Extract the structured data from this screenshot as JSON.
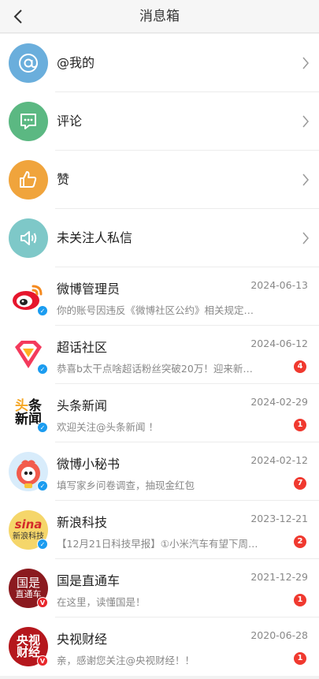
{
  "header": {
    "title": "消息箱"
  },
  "colors": {
    "at": "#6aaedc",
    "comment": "#5bb882",
    "like": "#f0a43c",
    "stranger": "#7ec8c8",
    "unread": "#f0392f",
    "verified_blue": "#1b9cf0",
    "verified_red": "#e8262b"
  },
  "categories": [
    {
      "label": "@我的",
      "icon": "at-icon"
    },
    {
      "label": "评论",
      "icon": "comment-icon"
    },
    {
      "label": "赞",
      "icon": "thumbs-up-icon"
    },
    {
      "label": "未关注人私信",
      "icon": "speaker-icon"
    }
  ],
  "messages": [
    {
      "name": "微博管理员",
      "date": "2024-06-13",
      "preview": "你的账号因违反《微博社区公约》相关规定，…",
      "unread": "",
      "badge": "blue"
    },
    {
      "name": "超话社区",
      "date": "2024-06-12",
      "preview": "恭喜b太干点啥超话粉丝突破20万！迎来新的…",
      "unread": "4",
      "badge": "blue"
    },
    {
      "name": "头条新闻",
      "date": "2024-02-29",
      "preview": "欢迎关注@头条新闻 ！",
      "unread": "1",
      "badge": "blue",
      "logo_line1_a": "头",
      "logo_line1_b": "条",
      "logo_line2": "新闻"
    },
    {
      "name": "微博小秘书",
      "date": "2024-02-12",
      "preview": "填写家乡问卷调查，抽现金红包",
      "unread": "7",
      "badge": "blue"
    },
    {
      "name": "新浪科技",
      "date": "2023-12-21",
      "preview": "【12月21日科技早报】①小米汽车有望下周发…",
      "unread": "2",
      "badge": "blue",
      "logo_top": "sina",
      "logo_bottom": "新浪科技"
    },
    {
      "name": "国是直通车",
      "date": "2021-12-29",
      "preview": "在这里，读懂国是！",
      "unread": "1",
      "badge": "red",
      "logo_top": "国是",
      "logo_bottom": "直通车"
    },
    {
      "name": "央视财经",
      "date": "2020-06-28",
      "preview": "亲，感谢您关注@央视财经！！",
      "unread": "1",
      "badge": "red",
      "logo_top": "央视",
      "logo_bottom": "财经"
    }
  ]
}
